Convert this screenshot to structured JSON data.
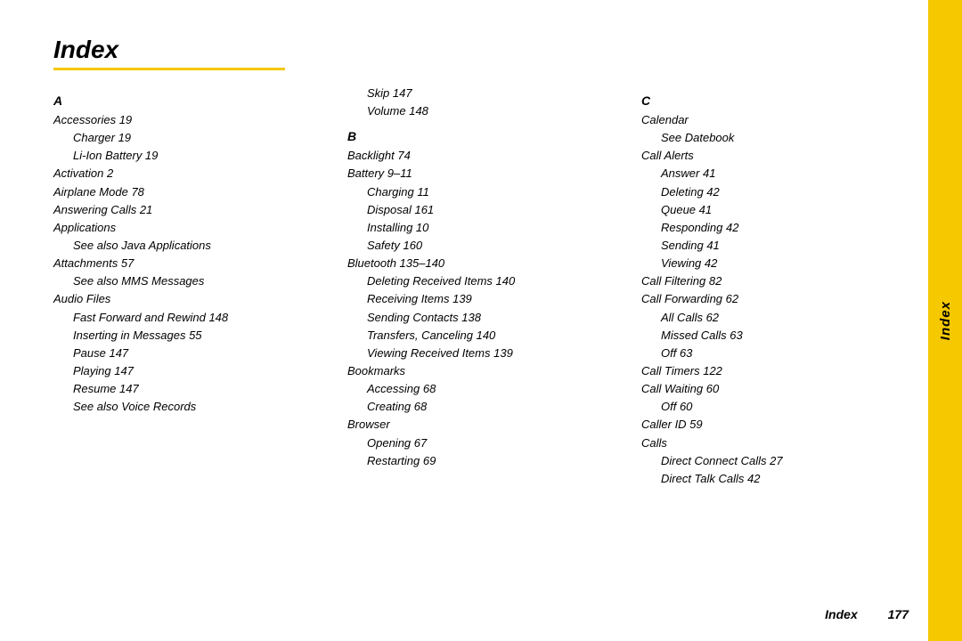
{
  "page": {
    "title": "Index",
    "underline_color": "#f5c800",
    "side_tab_label": "Index",
    "footer": {
      "label": "Index",
      "page_number": "177"
    }
  },
  "col_a": {
    "letter": "A",
    "entries": [
      {
        "text": "Accessories 19",
        "indent": 0
      },
      {
        "text": "Charger 19",
        "indent": 1
      },
      {
        "text": "Li-Ion Battery 19",
        "indent": 1
      },
      {
        "text": "Activation 2",
        "indent": 0
      },
      {
        "text": "Airplane Mode 78",
        "indent": 0
      },
      {
        "text": "Answering Calls 21",
        "indent": 0
      },
      {
        "text": "Applications",
        "indent": 0
      },
      {
        "text": "See also Java Applications",
        "indent": 1
      },
      {
        "text": "Attachments 57",
        "indent": 0
      },
      {
        "text": "See also MMS Messages",
        "indent": 1
      },
      {
        "text": "Audio Files",
        "indent": 0
      },
      {
        "text": "Fast Forward and Rewind 148",
        "indent": 1
      },
      {
        "text": "Inserting in Messages 55",
        "indent": 1
      },
      {
        "text": "Pause 147",
        "indent": 1
      },
      {
        "text": "Playing 147",
        "indent": 1
      },
      {
        "text": "Resume 147",
        "indent": 1
      },
      {
        "text": "See also Voice Records",
        "indent": 1
      }
    ]
  },
  "col_b": {
    "letter": "B",
    "pre_entries": [
      {
        "text": "Skip 147",
        "indent": 1
      },
      {
        "text": "Volume 148",
        "indent": 1
      }
    ],
    "entries": [
      {
        "text": "Backlight 74",
        "indent": 0
      },
      {
        "text": "Battery 9–11",
        "indent": 0
      },
      {
        "text": "Charging 11",
        "indent": 1
      },
      {
        "text": "Disposal 161",
        "indent": 1
      },
      {
        "text": "Installing 10",
        "indent": 1
      },
      {
        "text": "Safety 160",
        "indent": 1
      },
      {
        "text": "Bluetooth 135–140",
        "indent": 0
      },
      {
        "text": "Deleting Received Items 140",
        "indent": 1
      },
      {
        "text": "Receiving Items 139",
        "indent": 1
      },
      {
        "text": "Sending Contacts 138",
        "indent": 1
      },
      {
        "text": "Transfers, Canceling 140",
        "indent": 1
      },
      {
        "text": "Viewing Received Items 139",
        "indent": 1
      },
      {
        "text": "Bookmarks",
        "indent": 0
      },
      {
        "text": "Accessing 68",
        "indent": 1
      },
      {
        "text": "Creating 68",
        "indent": 1
      },
      {
        "text": "Browser",
        "indent": 0
      },
      {
        "text": "Opening 67",
        "indent": 1
      },
      {
        "text": "Restarting 69",
        "indent": 1
      }
    ]
  },
  "col_c": {
    "letter": "C",
    "entries": [
      {
        "text": "Calendar",
        "indent": 0
      },
      {
        "text": "See Datebook",
        "indent": 1
      },
      {
        "text": "Call Alerts",
        "indent": 0
      },
      {
        "text": "Answer 41",
        "indent": 1
      },
      {
        "text": "Deleting 42",
        "indent": 1
      },
      {
        "text": "Queue 41",
        "indent": 1
      },
      {
        "text": "Responding 42",
        "indent": 1
      },
      {
        "text": "Sending 41",
        "indent": 1
      },
      {
        "text": "Viewing 42",
        "indent": 1
      },
      {
        "text": "Call Filtering 82",
        "indent": 0
      },
      {
        "text": "Call Forwarding 62",
        "indent": 0
      },
      {
        "text": "All Calls 62",
        "indent": 1
      },
      {
        "text": "Missed Calls 63",
        "indent": 1
      },
      {
        "text": "Off 63",
        "indent": 1
      },
      {
        "text": "Call Timers 122",
        "indent": 0
      },
      {
        "text": "Call Waiting 60",
        "indent": 0
      },
      {
        "text": "Off 60",
        "indent": 1
      },
      {
        "text": "Caller ID 59",
        "indent": 0
      },
      {
        "text": "Calls",
        "indent": 0
      },
      {
        "text": "Direct Connect Calls 27",
        "indent": 1
      },
      {
        "text": "Direct Talk Calls 42",
        "indent": 1
      }
    ]
  }
}
